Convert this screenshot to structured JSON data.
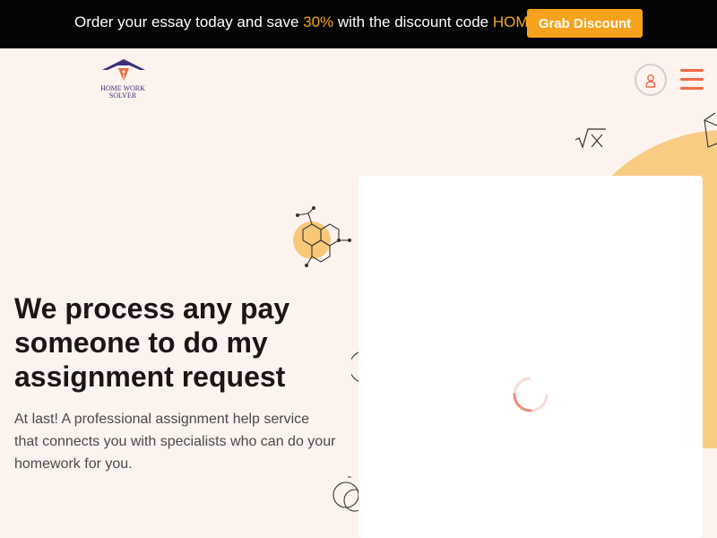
{
  "promo": {
    "text_before": "Order your essay today and save ",
    "discount": "30%",
    "text_middle": " with the discount code ",
    "code": "HOME",
    "button_label": "Grab Discount"
  },
  "logo": {
    "line1": "Home Work",
    "line2": "Solver"
  },
  "header": {
    "user_icon": "user-icon",
    "menu_icon": "hamburger-menu-icon"
  },
  "hero": {
    "headline": "We process any pay someone to do my assignment request",
    "lead": "At last! A professional assignment help service that connects you with specialists who can do your homework for you."
  },
  "form_card": {
    "state": "loading",
    "spinner_icon": "loading-spinner-icon"
  },
  "colors": {
    "accent": "#f6a21c",
    "brand_orange": "#ef6a45",
    "promo_background": "#050505",
    "page_background": "#fcf3ee",
    "decor_circle": "#f8c878",
    "logo_navy": "#3b2f7a"
  }
}
